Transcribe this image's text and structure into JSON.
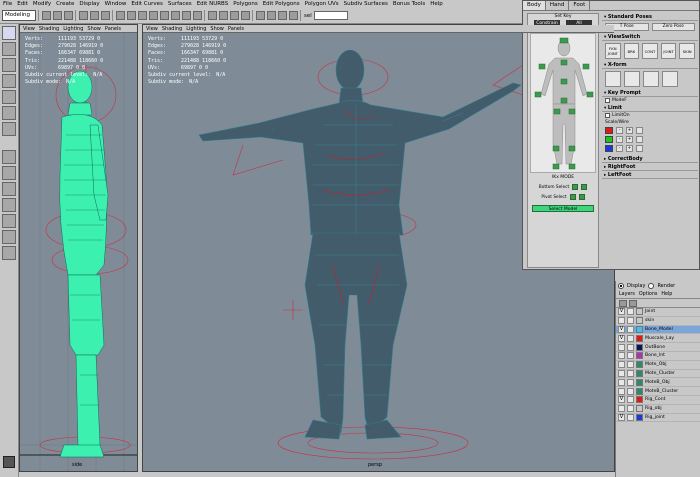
{
  "menubar": [
    "File",
    "Edit",
    "Modify",
    "Create",
    "Display",
    "Window",
    "Edit Curves",
    "Surfaces",
    "Edit NURBS",
    "Polygons",
    "Edit Polygons",
    "Polygon UVs",
    "Subdiv Surfaces",
    "Bonus Tools",
    "Help"
  ],
  "toolbar": {
    "mode": "Modeling",
    "sel_label": "sel"
  },
  "hud_labels": [
    "Verts:",
    "Edges:",
    "Faces:",
    "Tris:",
    "UVs:",
    "Subdiv current level:",
    "Subdiv mode:"
  ],
  "side_view": {
    "menu": [
      "View",
      "Shading",
      "Lighting",
      "Show",
      "Panels"
    ],
    "hud_values": [
      "111193 53729 0",
      "279028 146919 0",
      "166347 69881 0",
      "221488 118660 0",
      "69897 0 0",
      "N/A",
      "N/A"
    ],
    "name": "side"
  },
  "persp_view": {
    "menu": [
      "View",
      "Shading",
      "Lighting",
      "Show",
      "Panels"
    ],
    "hud_values": [
      "111193 53729 0",
      "279028 146919 0",
      "166347 69881 0",
      "221488 118660 0",
      "69897 0 0",
      "N/A",
      "N/A"
    ],
    "name": "persp"
  },
  "picker": {
    "tabs": [
      "Body",
      "Hand",
      "Foot"
    ],
    "set_key": "Set Key",
    "constrain": "Constrain",
    "all": "All",
    "ikfk_mode": "IKx MODE",
    "bottom_select": "Bottom Select",
    "pivot_select": "Pivot Select",
    "select_model": "Select Model"
  },
  "settings": {
    "standard_poses": "Standard Poses",
    "t_pose": "T Pose",
    "zero_pose": "Zero Pose",
    "view_switch": "ViewSwitch",
    "view_buttons": [
      "FKN JOINT",
      "BRK",
      "CONT",
      "JOINT",
      "SKIN"
    ],
    "x_form": "X-form",
    "key_prompt": "Key Prompt",
    "modef": "ModeF",
    "limit": "Limit",
    "limit_on": "LimitOn",
    "colors": "Scale/Wire",
    "color_swatches": [
      "#e01818",
      "#18c818",
      "#1838e0"
    ],
    "correct_body": "CorrectBody",
    "right_foot": "RightFoot",
    "left_foot": "LeftFoot"
  },
  "layers": {
    "display": "Display",
    "render": "Render",
    "menu": [
      "Layers",
      "Options",
      "Help"
    ],
    "items": [
      {
        "vis": "V",
        "color": "#c8c8c8",
        "name": "Joint",
        "selected": false
      },
      {
        "vis": "",
        "color": "#c8c8c8",
        "name": "skin",
        "selected": false
      },
      {
        "vis": "V",
        "color": "#40c0f0",
        "name": "Bone_Model",
        "selected": true
      },
      {
        "vis": "V",
        "color": "#e01818",
        "name": "Muscale_Lay",
        "selected": false
      },
      {
        "vis": "",
        "color": "#101060",
        "name": "OutBone",
        "selected": false
      },
      {
        "vis": "",
        "color": "#b030b0",
        "name": "Bone_lnt",
        "selected": false
      },
      {
        "vis": "",
        "color": "#2a8a6a",
        "name": "Mote_Obj",
        "selected": false
      },
      {
        "vis": "",
        "color": "#2a8a6a",
        "name": "Mote_Cluster",
        "selected": false
      },
      {
        "vis": "",
        "color": "#2a8a6a",
        "name": "MoteB_Obj",
        "selected": false
      },
      {
        "vis": "",
        "color": "#2a8a6a",
        "name": "MoteB_Cluster",
        "selected": false
      },
      {
        "vis": "V",
        "color": "#e01818",
        "name": "Rig_Cont",
        "selected": false
      },
      {
        "vis": "",
        "color": "#c8c8c8",
        "name": "Rig_obj",
        "selected": false
      },
      {
        "vis": "V",
        "color": "#1838e0",
        "name": "Rig_joint",
        "selected": false
      }
    ]
  },
  "colors": {
    "viewport_bg": "#7f8c97",
    "wire_green": "#3cf0b0",
    "wire_persp": "#2a7e8e",
    "rig_red": "#c83040"
  }
}
